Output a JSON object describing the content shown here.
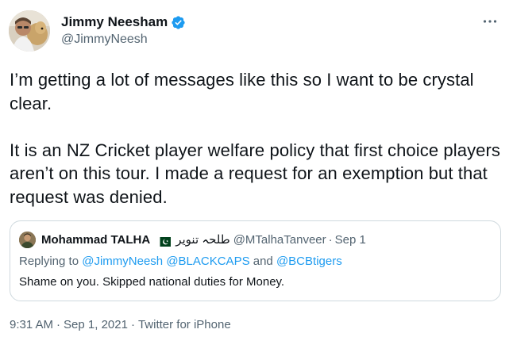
{
  "author": {
    "name": "Jimmy Neesham",
    "handle": "@JimmyNeesh",
    "verified": true,
    "badge_color": "#1d9bf0"
  },
  "more_icon": "more-horizontal-icon",
  "tweet": {
    "paragraphs": [
      "I’m getting a lot of messages like this so I want to be crystal clear.",
      "It is an NZ Cricket player welfare policy that first choice players aren’t on this tour. I made a request for an exemption but that request was denied."
    ]
  },
  "quote": {
    "name": "Mohammad TALHA",
    "flag": "pakistan-flag-icon",
    "name_urdu": "طلحہ تنویر",
    "handle": "@MTalhaTanveer",
    "separator": "·",
    "date": "Sep 1",
    "reply_prefix": "Replying to",
    "reply_mention_1": "@JimmyNeesh",
    "reply_mention_2": "@BLACKCAPS",
    "reply_and": "and",
    "reply_mention_3": "@BCBtigers",
    "text": "Shame on you. Skipped national duties for Money."
  },
  "meta": {
    "time": "9:31 AM",
    "separator": "·",
    "date": "Sep 1, 2021",
    "source": "Twitter for iPhone"
  },
  "colors": {
    "text": "#0f1419",
    "secondary": "#536471",
    "link": "#1d9bf0",
    "border": "#cfd9de"
  }
}
